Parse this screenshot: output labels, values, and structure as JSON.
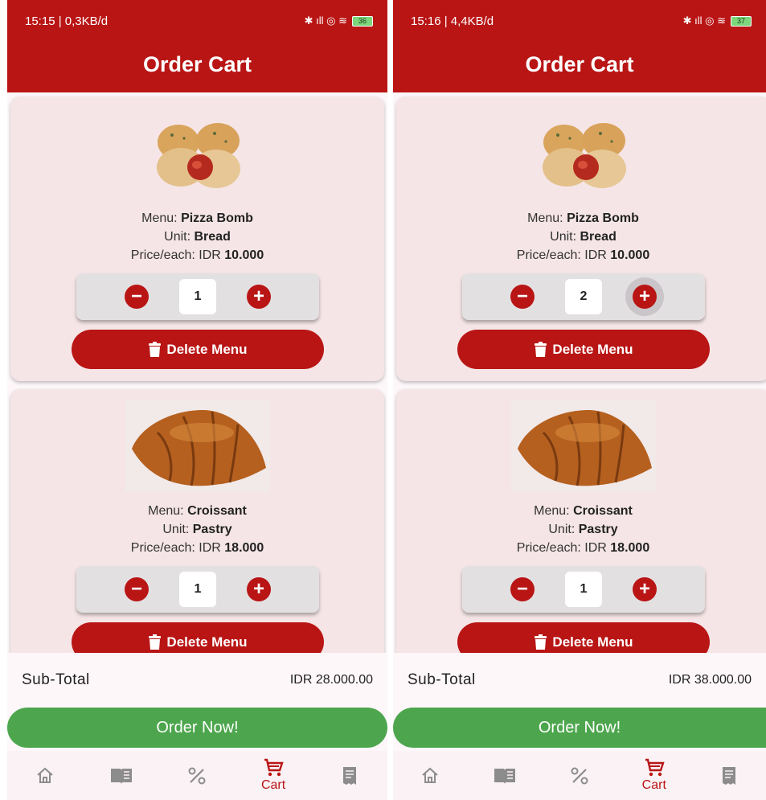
{
  "colors": {
    "primary": "#b91515",
    "order_button": "#4da64d",
    "card_bg": "#f5e5e6",
    "nav_inactive": "#8c8c8c"
  },
  "screens": [
    {
      "status": {
        "time_info": "15:15 | 0,3KB/d",
        "battery": "36"
      },
      "title": "Order Cart",
      "items": [
        {
          "menu_label": "Menu:",
          "menu_value": "Pizza Bomb",
          "unit_label": "Unit:",
          "unit_value": "Bread",
          "price_label": "Price/each: IDR",
          "price_value": "10.000",
          "quantity": "1",
          "image": "pizza-bomb"
        },
        {
          "menu_label": "Menu:",
          "menu_value": "Croissant",
          "unit_label": "Unit:",
          "unit_value": "Pastry",
          "price_label": "Price/each: IDR",
          "price_value": "18.000",
          "quantity": "1",
          "image": "croissant"
        }
      ],
      "delete_label": "Delete Menu",
      "subtotal_label": "Sub-Total",
      "subtotal_value": "IDR 28.000.00",
      "order_label": "Order Now!",
      "nav": [
        {
          "icon": "home-icon"
        },
        {
          "icon": "menu-book-icon"
        },
        {
          "icon": "percent-icon"
        },
        {
          "icon": "cart-icon",
          "label": "Cart",
          "active": true
        },
        {
          "icon": "receipt-icon"
        }
      ]
    },
    {
      "status": {
        "time_info": "15:16 | 4,4KB/d",
        "battery": "37"
      },
      "title": "Order Cart",
      "items": [
        {
          "menu_label": "Menu:",
          "menu_value": "Pizza Bomb",
          "unit_label": "Unit:",
          "unit_value": "Bread",
          "price_label": "Price/each: IDR",
          "price_value": "10.000",
          "quantity": "2",
          "image": "pizza-bomb"
        },
        {
          "menu_label": "Menu:",
          "menu_value": "Croissant",
          "unit_label": "Unit:",
          "unit_value": "Pastry",
          "price_label": "Price/each: IDR",
          "price_value": "18.000",
          "quantity": "1",
          "image": "croissant"
        }
      ],
      "delete_label": "Delete Menu",
      "subtotal_label": "Sub-Total",
      "subtotal_value": "IDR 38.000.00",
      "order_label": "Order Now!",
      "nav": [
        {
          "icon": "home-icon"
        },
        {
          "icon": "menu-book-icon"
        },
        {
          "icon": "percent-icon"
        },
        {
          "icon": "cart-icon",
          "label": "Cart",
          "active": true
        },
        {
          "icon": "receipt-icon"
        }
      ]
    }
  ]
}
